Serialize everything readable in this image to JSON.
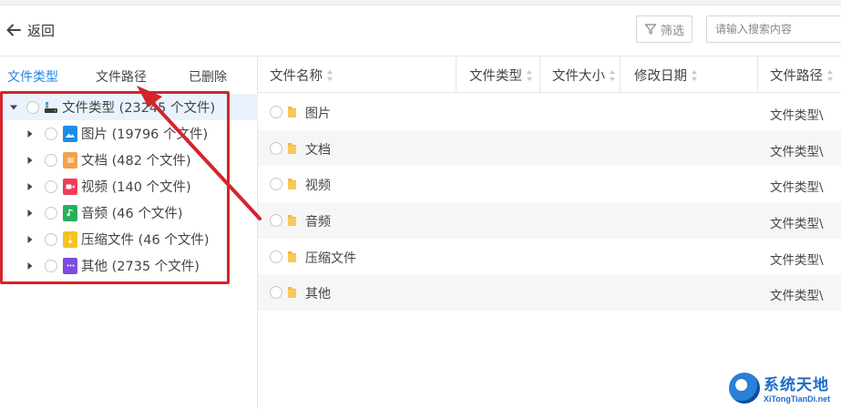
{
  "header": {
    "back_label": "返回",
    "filter_label": "筛选",
    "search_placeholder": "请输入搜索内容"
  },
  "left_tabs": [
    {
      "label": "文件类型",
      "active": true
    },
    {
      "label": "文件路径",
      "active": false
    },
    {
      "label": "已删除",
      "active": false
    }
  ],
  "tree": {
    "root": {
      "label": "文件类型 (23245 个文件)",
      "expanded": true
    },
    "children": [
      {
        "label": "图片 (19796 个文件)",
        "icon": "image-icon",
        "color": "#1e8de8"
      },
      {
        "label": "文档 (482 个文件)",
        "icon": "document-icon",
        "color": "#f5a04a"
      },
      {
        "label": "视频 (140 个文件)",
        "icon": "video-icon",
        "color": "#ef3e5a"
      },
      {
        "label": "音频 (46 个文件)",
        "icon": "audio-icon",
        "color": "#25b05c"
      },
      {
        "label": "压缩文件 (46 个文件)",
        "icon": "archive-icon",
        "color": "#f7c21e"
      },
      {
        "label": "其他 (2735 个文件)",
        "icon": "other-icon",
        "color": "#7b4de0"
      }
    ]
  },
  "table": {
    "columns": [
      "文件名称",
      "文件类型",
      "文件大小",
      "修改日期",
      "文件路径"
    ],
    "rows": [
      {
        "name": "图片",
        "path": "文件类型\\"
      },
      {
        "name": "文档",
        "path": "文件类型\\"
      },
      {
        "name": "视频",
        "path": "文件类型\\"
      },
      {
        "name": "音频",
        "path": "文件类型\\"
      },
      {
        "name": "压缩文件",
        "path": "文件类型\\"
      },
      {
        "name": "其他",
        "path": "文件类型\\"
      }
    ]
  },
  "watermark": {
    "title": "系统天地",
    "url": "XiTongTianDi.net"
  },
  "colors": {
    "accent": "#1f86e6",
    "annotation_red": "#d4252c",
    "folder": "#f5b83d"
  }
}
